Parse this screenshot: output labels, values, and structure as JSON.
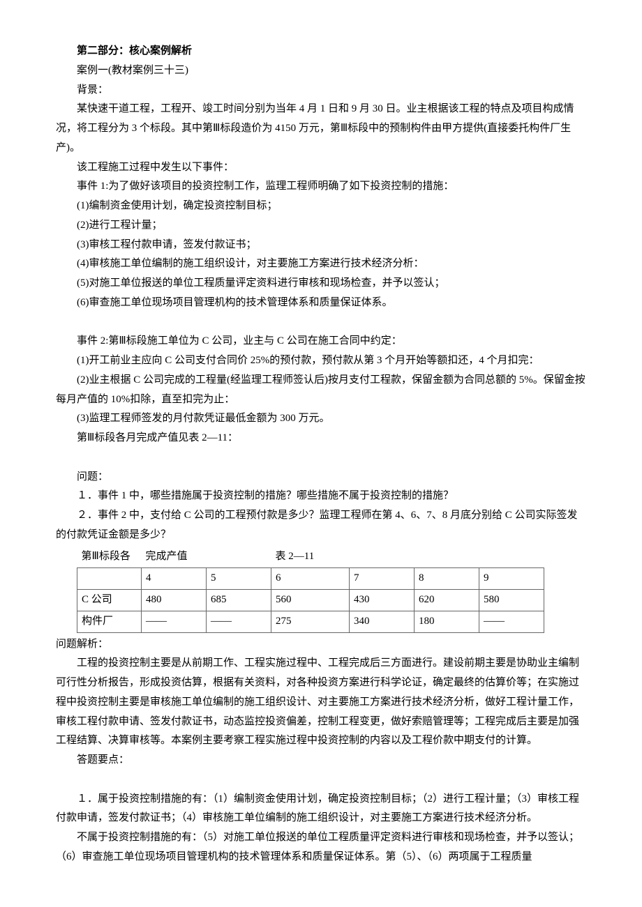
{
  "heading": "第二部分：核心案例解析",
  "case_name": "案例一(教材案例三十三)",
  "bg_label": "背景：",
  "bg_p1": "某快速干道工程，工程开、竣工时间分别为当年 4 月 1 日和 9 月 30 日。业主根据该工程的特点及项目构成情况，将工程分为 3 个标段。其中第Ⅲ标段造价为 4150 万元，第Ⅲ标段中的预制构件由甲方提供(直接委托构件厂生产)。",
  "bg_p2": "该工程施工过程中发生以下事件：",
  "event1_intro": "事件 1:为了做好该项目的投资控制工作，监理工程师明确了如下投资控制的措施：",
  "e1_1": "(1)编制资金使用计划，确定投资控制目标；",
  "e1_2": "(2)进行工程计量；",
  "e1_3": "(3)审核工程付款申请，签发付款证书；",
  "e1_4": "(4)审核施工单位编制的施工组织设计，对主要施工方案进行技术经济分析：",
  "e1_5": "(5)对施工单位报送的单位工程质量评定资料进行审核和现场检查，并予以签认；",
  "e1_6": "(6)审查施工单位现场项目管理机构的技术管理体系和质量保证体系。",
  "event2_intro": "事件 2:第Ⅲ标段施工单位为 C 公司，业主与 C 公司在施工合同中约定：",
  "e2_1": "(1)开工前业主应向 C 公司支付合同价 25%的预付款，预付款从第 3 个月开始等额扣还，4 个月扣完：",
  "e2_2": "(2)业主根据 C 公司完成的工程量(经监理工程师签认后)按月支付工程款，保留金额为合同总额的 5%。保留金按每月产值的 10%扣除，直至扣完为止：",
  "e2_3": "(3)监理工程师签发的月付款凭证最低金额为 300 万元。",
  "e2_4": "第Ⅲ标段各月完成产值见表 2—11：",
  "q_label": "问题：",
  "q1": "１．事件 1 中，哪些措施属于投资控制的措施？哪些措施不属于投资控制的措施？",
  "q2": "２．事件 2 中，支付给 C 公司的工程预付款是多少？监理工程师在第 4、6、7、8 月底分别给 C 公司实际签发的付款凭证金额是多少？",
  "table_title_left": "第Ⅲ标段各",
  "table_title_mid": "完成产值",
  "table_title_right": "表 2—11",
  "table": {
    "header": [
      "",
      "4",
      "5",
      "6",
      "7",
      "8",
      "9"
    ],
    "row1": [
      "C 公司",
      "480",
      "685",
      "560",
      "430",
      "620",
      "580"
    ],
    "row2": [
      "构件厂",
      "——",
      "——",
      "275",
      "340",
      "180",
      "——"
    ]
  },
  "analysis_label": "问题解析：",
  "analysis_p1": "工程的投资控制主要是从前期工作、工程实施过程中、工程完成后三方面进行。建设前期主要是协助业主编制可行性分析报告，形成投资估算，根据有关资料，对各种投资方案进行科学论证，确定最终的估算价等；在实施过程中投资控制主要是审核施工单位编制的施工组织设计、对主要施工方案进行技术经济分析，做好工程计量工作，审核工程付款申请、签发付款证书，动态监控投资偏差，控制工程变更，做好索赔管理等；工程完成后主要是加强工程结算、决算审核等。本案例主要考察工程实施过程中投资控制的内容以及工程价款中期支付的计算。",
  "answer_label": "答题要点：",
  "ans_p1": "１．属于投资控制措施的有：（1）编制资金使用计划，确定投资控制目标；（2）进行工程计量；（3）审核工程付款申请，签发付款证书；（4）审核施工单位编制的施工组织设计，对主要施工方案进行技术经济分析。",
  "ans_p2": "不属于投资控制措施的有：（5）对施工单位报送的单位工程质量评定资料进行审核和现场检查，并予以签认；（6）审查施工单位现场项目管理机构的技术管理体系和质量保证体系。第（5）、（6）两项属于工程质量"
}
